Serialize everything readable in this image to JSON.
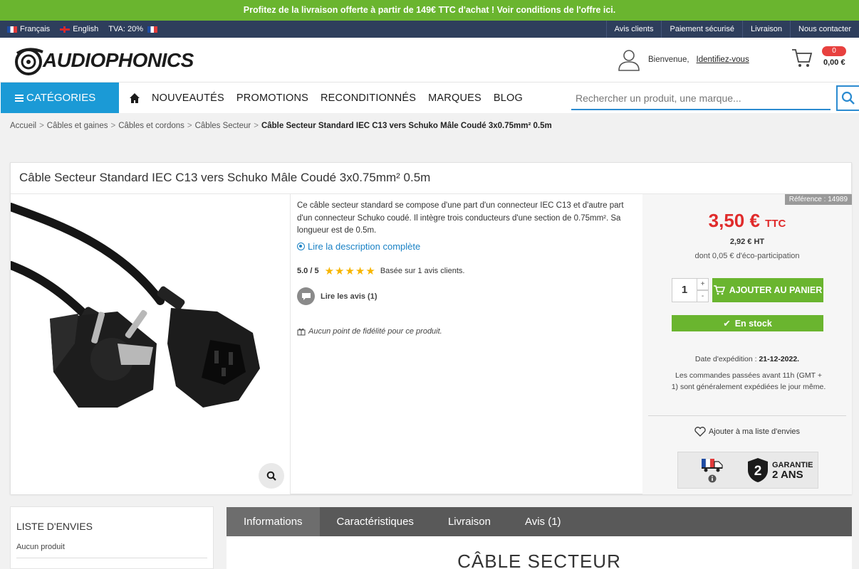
{
  "promo": {
    "text": "Profitez de la livraison offerte à partir de 149€ TTC d'achat ! Voir conditions de l'offre ici."
  },
  "topbar": {
    "lang_fr": "Français",
    "lang_en": "English",
    "tva": "TVA: 20%",
    "links": [
      "Avis clients",
      "Paiement sécurisé",
      "Livraison",
      "Nous contacter"
    ]
  },
  "header": {
    "logo_text": "AUDIOPHONICS",
    "welcome": "Bienvenue,",
    "identify": "Identifiez-vous",
    "cart_count": "0",
    "cart_total": "0,00 €"
  },
  "nav": {
    "categories": "CATÉGORIES",
    "items": [
      "NOUVEAUTÉS",
      "PROMOTIONS",
      "RECONDITIONNÉS",
      "MARQUES",
      "BLOG"
    ],
    "search_placeholder": "Rechercher un produit, une marque..."
  },
  "breadcrumb": {
    "items": [
      "Accueil",
      "Câbles et gaines",
      "Câbles et cordons",
      "Câbles Secteur"
    ],
    "current": "Câble Secteur Standard IEC C13 vers Schuko Mâle Coudé 3x0.75mm² 0.5m",
    "sep": ">"
  },
  "product": {
    "title": "Câble Secteur Standard IEC C13 vers Schuko Mâle Coudé 3x0.75mm² 0.5m",
    "description": "Ce câble secteur standard se compose d'une part d'un connecteur IEC C13 et d'autre part d'un connecteur Schuko coudé. Il intègre trois conducteurs d'une section de 0.75mm². Sa longueur est de 0.5m.",
    "read_more": "Lire la description complète",
    "score": "5.0 / 5",
    "stars": 5,
    "rating_text": "Basée sur 1 avis clients.",
    "reviews_link": "Lire les avis (1)",
    "loyalty": "Aucun point de fidélité pour ce produit."
  },
  "buy": {
    "reference": "Référence : 14989",
    "price": "3,50 €",
    "price_suffix": "TTC",
    "price_ht": "2,92 € HT",
    "eco": "dont 0,05 € d'éco-participation",
    "qty": "1",
    "plus": "+",
    "minus": "-",
    "add_to_cart": "AJOUTER AU PANIER",
    "stock": "En stock",
    "ship_label": "Date d'expédition :",
    "ship_date": "21-12-2022.",
    "ship_note": "Les commandes passées avant 11h (GMT + 1) sont généralement expédiées le jour même.",
    "wishlist": "Ajouter à ma liste d'envies",
    "guarantee_l1": "GARANTIE",
    "guarantee_l2": "2 ANS",
    "guarantee_num": "2"
  },
  "wish_box": {
    "title": "LISTE D'ENVIES",
    "empty": "Aucun produit"
  },
  "tabs": {
    "items": [
      "Informations",
      "Caractéristiques",
      "Livraison",
      "Avis (1)"
    ],
    "heading": "CÂBLE SECTEUR"
  },
  "colors": {
    "green": "#6ab52f",
    "navy": "#2e3e5c",
    "blue": "#1b9ad6",
    "price_red": "#e02b2b"
  }
}
